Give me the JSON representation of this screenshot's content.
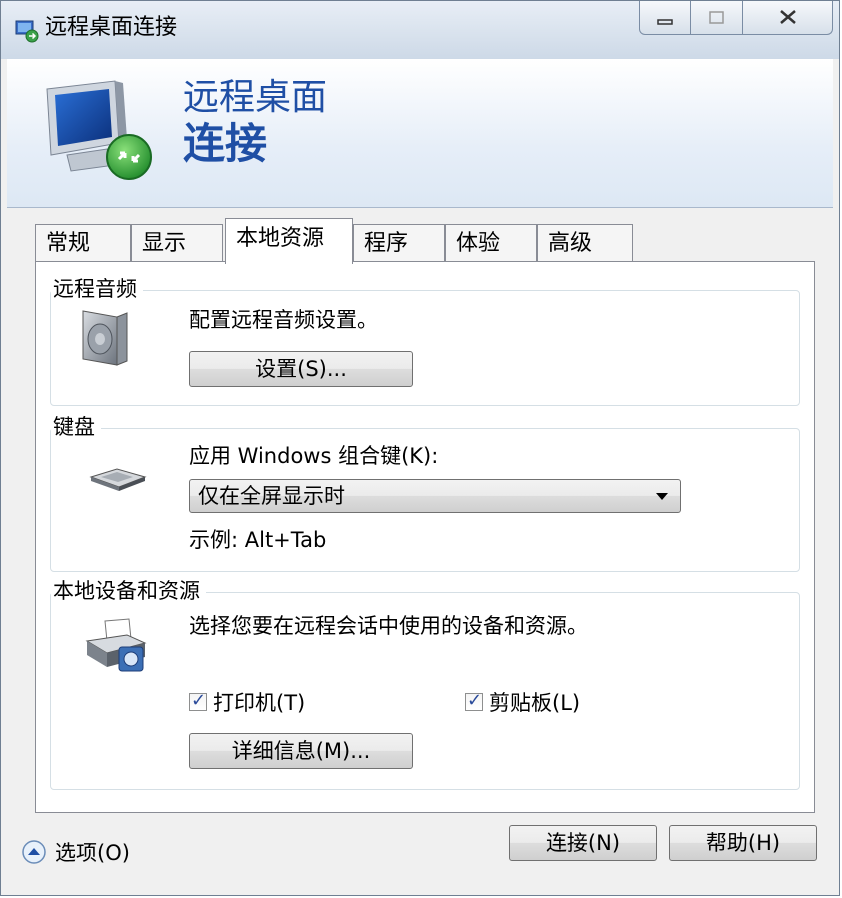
{
  "window": {
    "title": "远程桌面连接",
    "caption": {
      "minimize_glyph": "—",
      "maximize_glyph": "□",
      "close_glyph": "✕"
    }
  },
  "banner": {
    "line1": "远程桌面",
    "line2": "连接"
  },
  "tabs": [
    {
      "label": "常规",
      "active": false
    },
    {
      "label": "显示",
      "active": false
    },
    {
      "label": "本地资源",
      "active": true
    },
    {
      "label": "程序",
      "active": false
    },
    {
      "label": "体验",
      "active": false
    },
    {
      "label": "高级",
      "active": false
    }
  ],
  "audio": {
    "group_title": "远程音频",
    "description": "配置远程音频设置。",
    "settings_button": "设置(S)..."
  },
  "keyboard": {
    "group_title": "键盘",
    "apply_label": "应用 Windows 组合键(K):",
    "selected_option": "仅在全屏显示时",
    "example": "示例: Alt+Tab"
  },
  "devices": {
    "group_title": "本地设备和资源",
    "description": "选择您要在远程会话中使用的设备和资源。",
    "printer_label": "打印机(T)",
    "printer_checked": true,
    "clipboard_label": "剪贴板(L)",
    "clipboard_checked": true,
    "details_button": "详细信息(M)..."
  },
  "footer": {
    "options_label": "选项(O)",
    "connect_button": "连接(N)",
    "help_button": "帮助(H)"
  },
  "colors": {
    "banner_text": "#1f4fa5",
    "title_bar": "#cdd9e7"
  }
}
